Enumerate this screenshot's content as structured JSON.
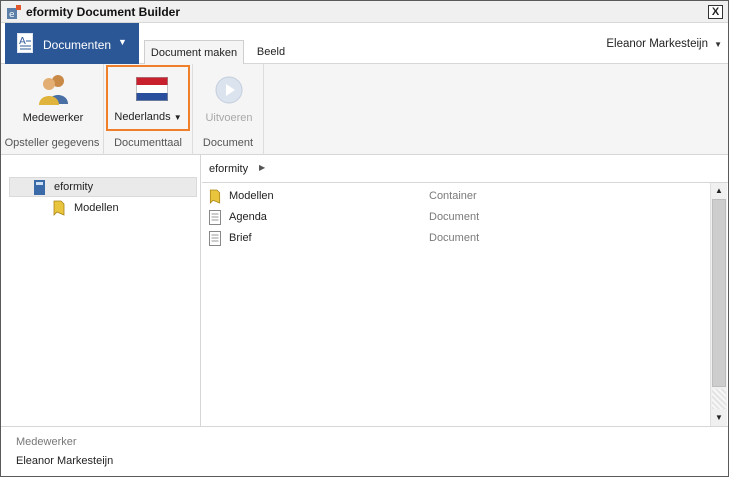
{
  "window": {
    "title": "eformity Document Builder",
    "close_glyph": "X"
  },
  "menubar": {
    "app_menu_label": "Documenten",
    "tabs": [
      {
        "label": "Document maken",
        "active": true
      },
      {
        "label": "Beeld",
        "active": false
      }
    ],
    "user_name": "Eleanor Markesteijn"
  },
  "ribbon": {
    "groups": [
      {
        "label": "Opsteller gegevens",
        "buttons": [
          {
            "label": "Medewerker",
            "icon": "users-icon"
          }
        ]
      },
      {
        "label": "Documenttaal",
        "buttons": [
          {
            "label": "Nederlands",
            "icon": "flag-nl-icon",
            "dropdown": true
          }
        ]
      },
      {
        "label": "Document",
        "buttons": [
          {
            "label": "Uitvoeren",
            "icon": "play-icon",
            "disabled": true
          }
        ]
      }
    ]
  },
  "tree": {
    "items": [
      {
        "label": "eformity",
        "icon": "book-icon",
        "selected": true
      },
      {
        "label": "Modellen",
        "icon": "folder-icon"
      }
    ]
  },
  "breadcrumb": {
    "path": "eformity"
  },
  "list": {
    "rows": [
      {
        "name": "Modellen",
        "type": "Container",
        "icon": "folder-icon"
      },
      {
        "name": "Agenda",
        "type": "Document",
        "icon": "document-icon"
      },
      {
        "name": "Brief",
        "type": "Document",
        "icon": "document-icon"
      }
    ]
  },
  "status": {
    "label": "Medewerker",
    "value": "Eleanor Markesteijn"
  },
  "colors": {
    "accent": "#2b5797",
    "highlight": "#f07f2a"
  }
}
